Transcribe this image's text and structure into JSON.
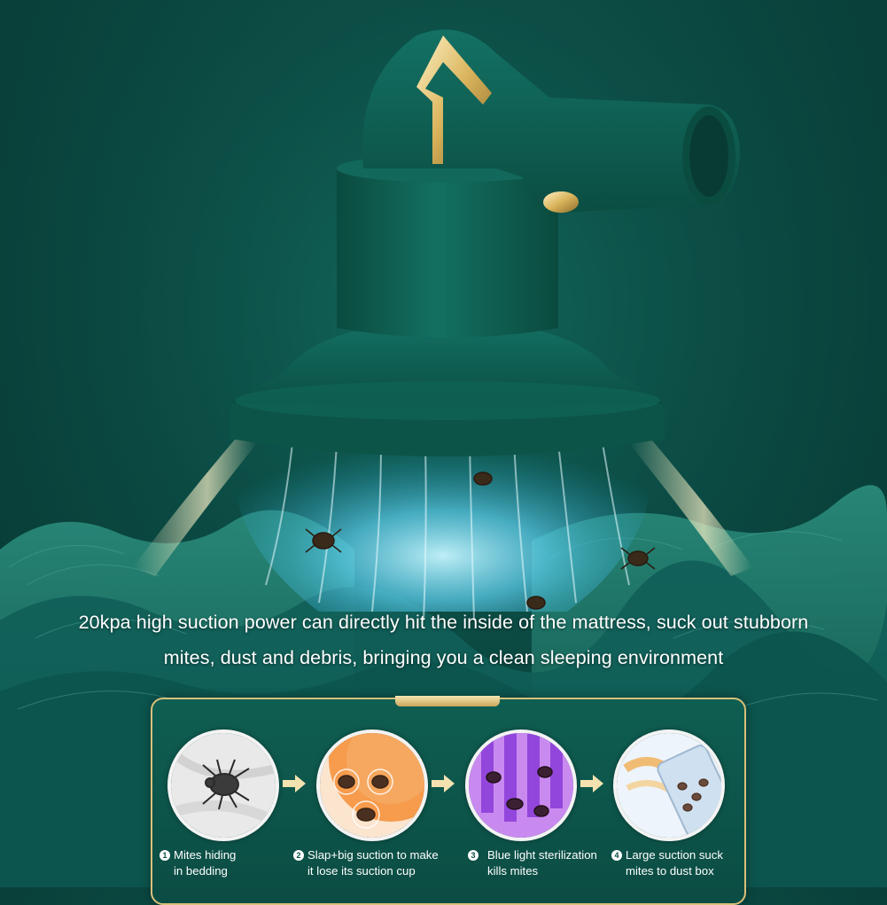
{
  "headline": {
    "line1": "20kpa high suction power can directly hit the inside of the mattress, suck out stubborn",
    "line2": "mites, dust and debris, bringing you a clean sleeping environment"
  },
  "steps": [
    {
      "number": "1",
      "line1": "Mites hiding",
      "line2": "in bedding"
    },
    {
      "number": "2",
      "line1": "Slap+big suction to make",
      "line2": "it lose its suction cup"
    },
    {
      "number": "3",
      "line1": "Blue light sterilization",
      "line2": "kills mites"
    },
    {
      "number": "4",
      "line1": "Large suction suck",
      "line2": "mites to dust box"
    }
  ],
  "colors": {
    "background": "#0a4740",
    "device_body": "#0e5a4c",
    "gold_accent": "#d9b45c",
    "suction_glow": "#8fe7ff"
  },
  "icons": [
    "vacuum-device-illustration",
    "mite-icon",
    "arrow-right-icon"
  ]
}
